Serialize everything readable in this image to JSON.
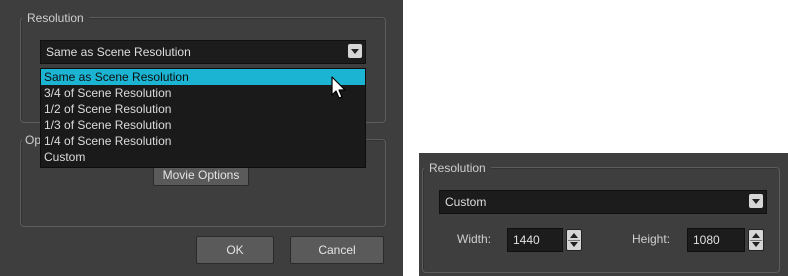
{
  "left_dialog": {
    "resolution_group": {
      "title": "Resolution",
      "combo_value": "Same as Scene Resolution",
      "options": [
        {
          "label": "Same as Scene Resolution",
          "selected": true
        },
        {
          "label": "3/4 of Scene Resolution",
          "selected": false
        },
        {
          "label": "1/2 of Scene Resolution",
          "selected": false
        },
        {
          "label": "1/3 of Scene Resolution",
          "selected": false
        },
        {
          "label": "1/4 of Scene Resolution",
          "selected": false
        },
        {
          "label": "Custom",
          "selected": false
        }
      ]
    },
    "options_group": {
      "title_partial": "Op",
      "movie_options_label": "Movie Options"
    },
    "buttons": {
      "ok_label": "OK",
      "cancel_label": "Cancel"
    }
  },
  "right_dialog": {
    "resolution_group": {
      "title": "Resolution",
      "combo_value": "Custom",
      "width_label": "Width:",
      "width_value": "1440",
      "height_label": "Height:",
      "height_value": "1080"
    }
  },
  "colors": {
    "panel_bg": "#3e3e3e",
    "highlight": "#1bb4d3",
    "field_bg": "#1c1c1c"
  }
}
